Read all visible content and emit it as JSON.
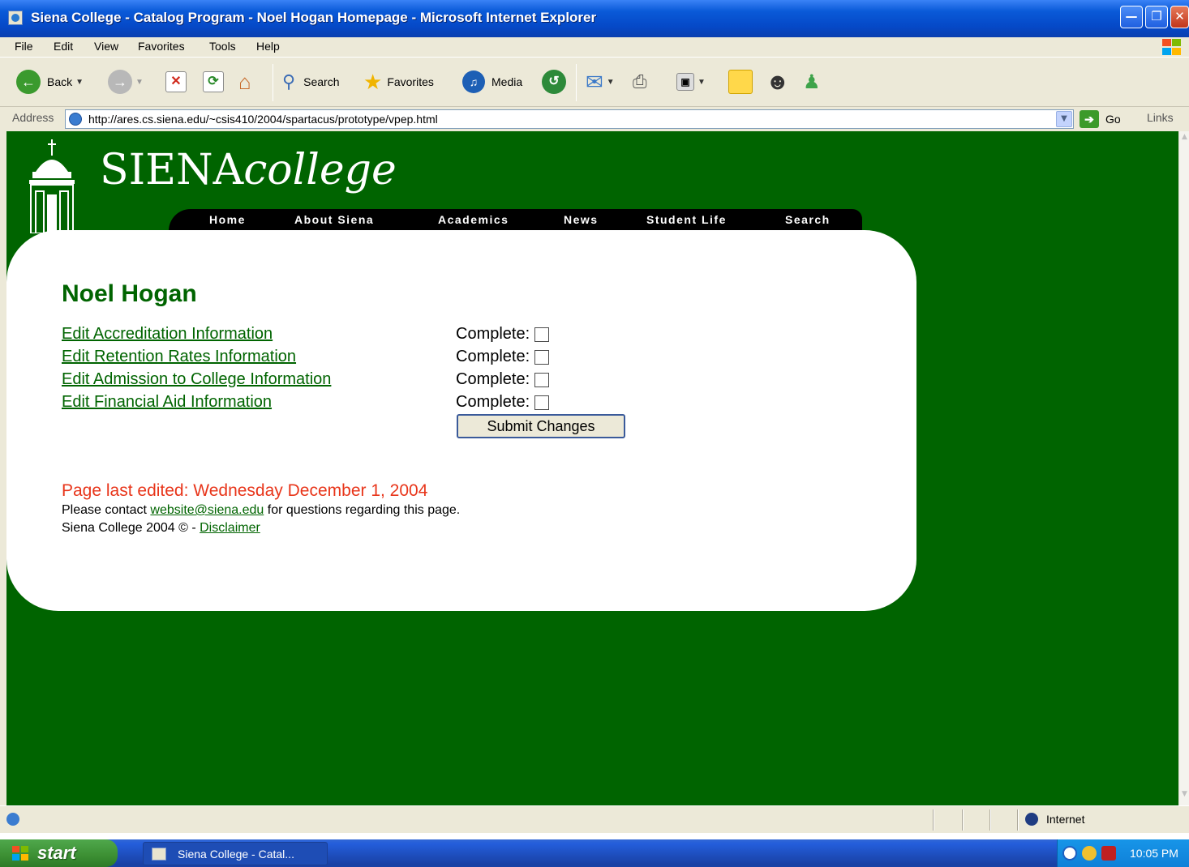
{
  "window": {
    "title": "Siena College - Catalog Program - Noel Hogan Homepage - Microsoft Internet Explorer",
    "controls": [
      "minimize",
      "maximize",
      "close"
    ]
  },
  "menu": {
    "items": [
      "File",
      "Edit",
      "View",
      "Favorites",
      "Tools",
      "Help"
    ]
  },
  "toolbar": {
    "back_label": "Back",
    "search_label": "Search",
    "favorites_label": "Favorites",
    "media_label": "Media"
  },
  "address": {
    "label": "Address",
    "url": "http://ares.cs.siena.edu/~csis410/2004/spartacus/prototype/vpep.html",
    "go_label": "Go",
    "links_label": "Links"
  },
  "site": {
    "logo_main": "SIENA",
    "logo_italic": "college",
    "nav": [
      "Home",
      "About Siena",
      "Academics",
      "News",
      "Student Life",
      "Search"
    ]
  },
  "content": {
    "heading": "Noel Hogan",
    "edit_links": [
      "Edit Accreditation Information",
      "Edit Retention Rates Information",
      "Edit Admission to College Information",
      "Edit Financial Aid Information"
    ],
    "complete_label": "Complete:",
    "complete_checked": [
      false,
      false,
      false,
      false
    ],
    "submit_label": "Submit Changes",
    "last_edited": "Page last edited: Wednesday December 1, 2004",
    "contact_prefix": "Please contact ",
    "contact_email": "website@siena.edu",
    "contact_suffix": " for questions regarding this page.",
    "copyright_prefix": "Siena College 2004 © - ",
    "disclaimer_label": "Disclaimer"
  },
  "statusbar": {
    "zone": "Internet"
  },
  "taskbar": {
    "start_label": "start",
    "task_label": "Siena College - Catal...",
    "clock": "10:05 PM"
  },
  "colors": {
    "page_background": "#006400",
    "link": "#006400",
    "last_edited_text": "#e8351a"
  },
  "icons": [
    "ie-page-icon",
    "back-arrow-icon",
    "forward-arrow-icon",
    "stop-icon",
    "refresh-icon",
    "home-icon",
    "search-magnifier-icon",
    "favorites-star-icon",
    "media-icon",
    "history-icon",
    "mail-icon",
    "print-icon",
    "edit-icon",
    "discuss-icon",
    "messenger-icon",
    "research-icon",
    "go-arrow-icon",
    "internet-globe-icon",
    "windows-flag-icon"
  ]
}
